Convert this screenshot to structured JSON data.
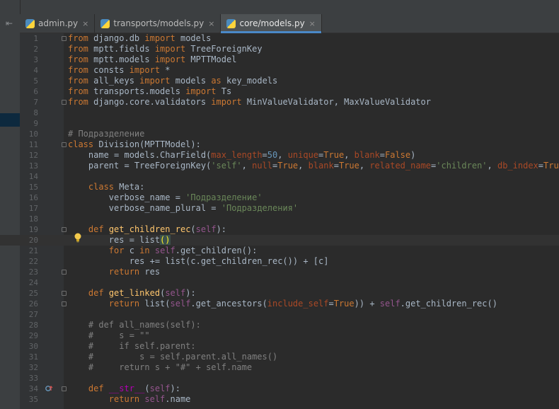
{
  "tabs": [
    {
      "label": "admin.py",
      "close": "×",
      "active": false
    },
    {
      "label": "transports/models.py",
      "close": "×",
      "active": false
    },
    {
      "label": "core/models.py",
      "close": "×",
      "active": true
    }
  ],
  "colors": {
    "background": "#2b2b2b",
    "keyword": "#cc7832",
    "string": "#6a8759",
    "number": "#6897bb",
    "comment": "#808080",
    "self": "#94558d",
    "kwarg": "#aa4926",
    "function": "#ffc66d"
  },
  "icons": [
    "collapse-icon",
    "python-file-icon",
    "lightbulb-icon",
    "override-marker-icon"
  ],
  "current_line": 20,
  "lines": [
    {
      "n": "1",
      "code": [
        [
          "kw",
          "from"
        ],
        [
          "t",
          " django.db "
        ],
        [
          "kw",
          "import"
        ],
        [
          "t",
          " models"
        ]
      ]
    },
    {
      "n": "2",
      "code": [
        [
          "kw",
          "from"
        ],
        [
          "t",
          " mptt.fields "
        ],
        [
          "kw",
          "import"
        ],
        [
          "t",
          " TreeForeignKey"
        ]
      ]
    },
    {
      "n": "3",
      "code": [
        [
          "kw",
          "from"
        ],
        [
          "t",
          " mptt.models "
        ],
        [
          "kw",
          "import"
        ],
        [
          "t",
          " MPTTModel"
        ]
      ]
    },
    {
      "n": "4",
      "code": [
        [
          "kw",
          "from"
        ],
        [
          "t",
          " consts "
        ],
        [
          "kw",
          "import"
        ],
        [
          "t",
          " *"
        ]
      ]
    },
    {
      "n": "5",
      "code": [
        [
          "kw",
          "from"
        ],
        [
          "t",
          " all_keys "
        ],
        [
          "kw",
          "import"
        ],
        [
          "t",
          " models "
        ],
        [
          "kw",
          "as"
        ],
        [
          "t",
          " key_models"
        ]
      ]
    },
    {
      "n": "6",
      "code": [
        [
          "kw",
          "from"
        ],
        [
          "t",
          " transports.models "
        ],
        [
          "kw",
          "import"
        ],
        [
          "t",
          " Ts"
        ]
      ]
    },
    {
      "n": "7",
      "code": [
        [
          "kw",
          "from"
        ],
        [
          "t",
          " django.core.validators "
        ],
        [
          "kw",
          "import"
        ],
        [
          "t",
          " MinValueValidator, MaxValueValidator"
        ]
      ]
    },
    {
      "n": "8",
      "code": []
    },
    {
      "n": "9",
      "code": []
    },
    {
      "n": "10",
      "code": [
        [
          "cm",
          "# Подразделение"
        ]
      ]
    },
    {
      "n": "11",
      "code": [
        [
          "kw",
          "class"
        ],
        [
          "t",
          " Division(MPTTModel):"
        ]
      ]
    },
    {
      "n": "12",
      "code": [
        [
          "t",
          "    name = models.CharField("
        ],
        [
          "kwarg",
          "max_length"
        ],
        [
          "t",
          "="
        ],
        [
          "num",
          "50"
        ],
        [
          "t",
          ", "
        ],
        [
          "kwarg",
          "unique"
        ],
        [
          "t",
          "="
        ],
        [
          "kw",
          "True"
        ],
        [
          "t",
          ", "
        ],
        [
          "kwarg",
          "blank"
        ],
        [
          "t",
          "="
        ],
        [
          "kw",
          "False"
        ],
        [
          "t",
          ")"
        ]
      ]
    },
    {
      "n": "13",
      "code": [
        [
          "t",
          "    parent = TreeForeignKey("
        ],
        [
          "str",
          "'self'"
        ],
        [
          "t",
          ", "
        ],
        [
          "kwarg",
          "null"
        ],
        [
          "t",
          "="
        ],
        [
          "kw",
          "True"
        ],
        [
          "t",
          ", "
        ],
        [
          "kwarg",
          "blank"
        ],
        [
          "t",
          "="
        ],
        [
          "kw",
          "True"
        ],
        [
          "t",
          ", "
        ],
        [
          "kwarg",
          "related_name"
        ],
        [
          "t",
          "="
        ],
        [
          "str",
          "'children'"
        ],
        [
          "t",
          ", "
        ],
        [
          "kwarg",
          "db_index"
        ],
        [
          "t",
          "="
        ],
        [
          "kw",
          "True"
        ],
        [
          "t",
          ")"
        ]
      ]
    },
    {
      "n": "14",
      "code": []
    },
    {
      "n": "15",
      "code": [
        [
          "t",
          "    "
        ],
        [
          "kw",
          "class"
        ],
        [
          "t",
          " Meta:"
        ]
      ]
    },
    {
      "n": "16",
      "code": [
        [
          "t",
          "        verbose_name = "
        ],
        [
          "str",
          "'Подразделение'"
        ]
      ]
    },
    {
      "n": "17",
      "code": [
        [
          "t",
          "        verbose_name_plural = "
        ],
        [
          "str",
          "'Подразделения'"
        ]
      ]
    },
    {
      "n": "18",
      "code": []
    },
    {
      "n": "19",
      "code": [
        [
          "t",
          "    "
        ],
        [
          "kw",
          "def"
        ],
        [
          "fn",
          " get_children_rec"
        ],
        [
          "t",
          "("
        ],
        [
          "self",
          "self"
        ],
        [
          "t",
          "):"
        ]
      ]
    },
    {
      "n": "20",
      "code": [
        [
          "t",
          "        res = list"
        ],
        [
          "bracket",
          "("
        ],
        [
          "bracket",
          ")"
        ]
      ]
    },
    {
      "n": "21",
      "code": [
        [
          "t",
          "        "
        ],
        [
          "kw",
          "for"
        ],
        [
          "t",
          " c "
        ],
        [
          "kw",
          "in"
        ],
        [
          "self",
          " self"
        ],
        [
          "t",
          ".get_children():"
        ]
      ]
    },
    {
      "n": "22",
      "code": [
        [
          "t",
          "            res += list(c.get_children_rec()) + [c]"
        ]
      ]
    },
    {
      "n": "23",
      "code": [
        [
          "t",
          "        "
        ],
        [
          "kw",
          "return"
        ],
        [
          "t",
          " res"
        ]
      ]
    },
    {
      "n": "24",
      "code": []
    },
    {
      "n": "25",
      "code": [
        [
          "t",
          "    "
        ],
        [
          "kw",
          "def"
        ],
        [
          "fn",
          " get_linked"
        ],
        [
          "t",
          "("
        ],
        [
          "self",
          "self"
        ],
        [
          "t",
          "):"
        ]
      ]
    },
    {
      "n": "26",
      "code": [
        [
          "t",
          "        "
        ],
        [
          "kw",
          "return"
        ],
        [
          "t",
          " list("
        ],
        [
          "self",
          "self"
        ],
        [
          "t",
          ".get_ancestors("
        ],
        [
          "kwarg",
          "include_self"
        ],
        [
          "t",
          "="
        ],
        [
          "kw",
          "True"
        ],
        [
          "t",
          ")) + "
        ],
        [
          "self",
          "self"
        ],
        [
          "t",
          ".get_children_rec()"
        ]
      ]
    },
    {
      "n": "27",
      "code": []
    },
    {
      "n": "28",
      "code": [
        [
          "cm",
          "    # def all_names(self):"
        ]
      ]
    },
    {
      "n": "29",
      "code": [
        [
          "cm",
          "    #     s = \"\""
        ]
      ]
    },
    {
      "n": "30",
      "code": [
        [
          "cm",
          "    #     if self.parent:"
        ]
      ]
    },
    {
      "n": "31",
      "code": [
        [
          "cm",
          "    #         s = self.parent.all_names()"
        ]
      ]
    },
    {
      "n": "32",
      "code": [
        [
          "cm",
          "    #     return s + \"#\" + self.name"
        ]
      ]
    },
    {
      "n": "33",
      "code": []
    },
    {
      "n": "34",
      "code": [
        [
          "t",
          "    "
        ],
        [
          "kw",
          "def"
        ],
        [
          "magic",
          " __str__"
        ],
        [
          "t",
          "("
        ],
        [
          "self",
          "self"
        ],
        [
          "t",
          "):"
        ]
      ]
    },
    {
      "n": "35",
      "code": [
        [
          "t",
          "        "
        ],
        [
          "kw",
          "return"
        ],
        [
          "self",
          " self"
        ],
        [
          "t",
          ".name"
        ]
      ]
    }
  ]
}
